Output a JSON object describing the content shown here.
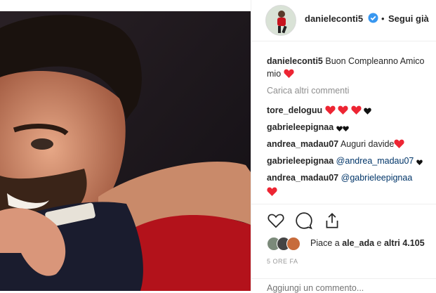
{
  "post": {
    "header": {
      "username": "danieleconti5",
      "follow_label": "Segui già",
      "separator": "•"
    },
    "caption": {
      "username": "danieleconti5",
      "text": "Buon Compleanno Amico mio"
    },
    "load_more_label": "Carica altri commenti",
    "comments": [
      {
        "username": "tore_deloguu",
        "text": ""
      },
      {
        "username": "gabrieleepignaa",
        "text": ""
      },
      {
        "username": "andrea_madau07",
        "text": "Auguri davide"
      },
      {
        "username": "gabrieleepignaa",
        "text": "@andrea_madau07"
      },
      {
        "username": "andrea_madau07",
        "text": "@gabrieleepignaa"
      }
    ],
    "likes": {
      "prefix": "Piace a",
      "first_user": "ale_ada",
      "middle": "e",
      "others_label": "altri 4.105"
    },
    "time_ago": "5 ORE FA",
    "add_comment_placeholder": "Aggiungi un commento...",
    "colors": {
      "heart_red": "#ed2533",
      "verified_blue": "#3897f0",
      "text": "#262626",
      "muted": "#8e8e8e"
    }
  }
}
